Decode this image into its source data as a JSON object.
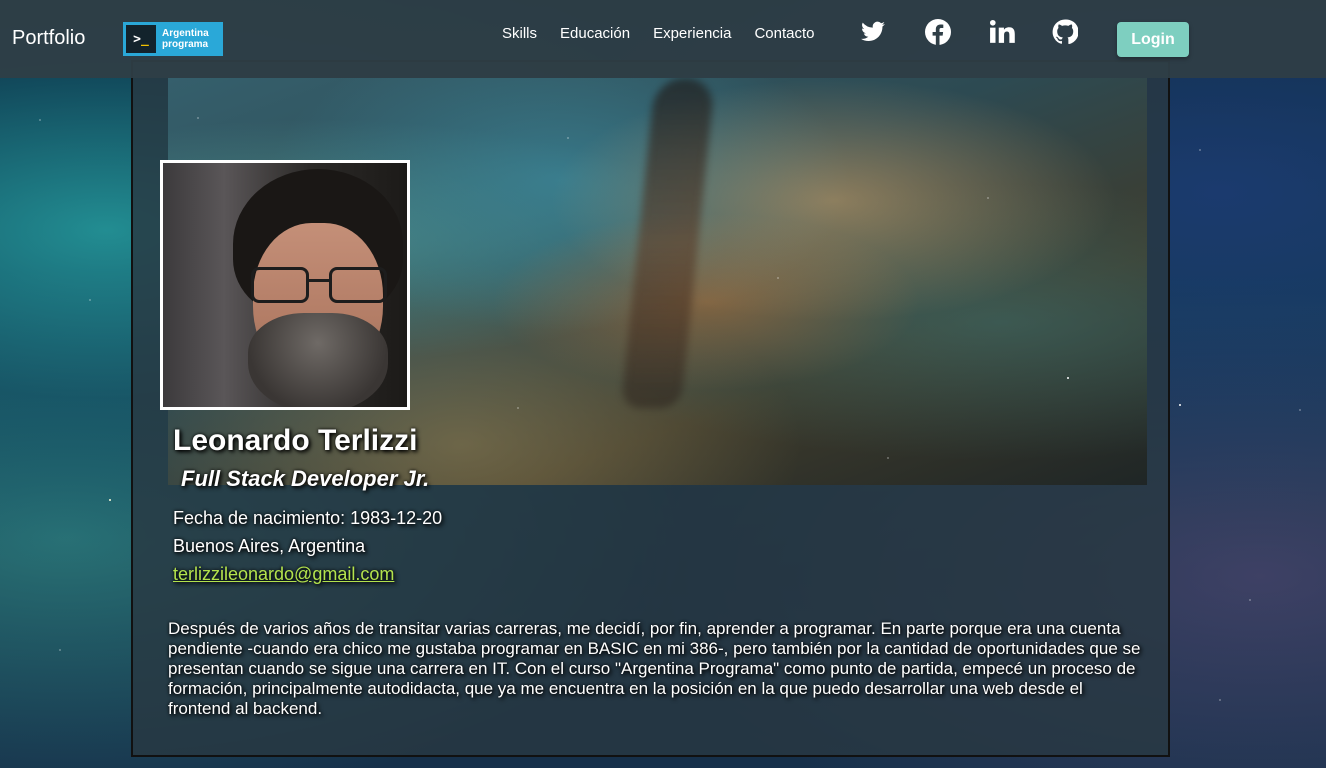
{
  "navbar": {
    "brand": "Portfolio",
    "logo": {
      "prompt": ">",
      "cursor": "_",
      "line1": "Argentina",
      "line2": "programa"
    },
    "links": [
      "Skills",
      "Educación",
      "Experiencia",
      "Contacto"
    ],
    "social_icons": [
      "twitter-icon",
      "facebook-icon",
      "linkedin-icon",
      "github-icon"
    ],
    "login_label": "Login"
  },
  "profile": {
    "name": "Leonardo Terlizzi",
    "title": "Full Stack Developer Jr.",
    "birth": "Fecha de nacimiento: 1983-12-20",
    "location": "Buenos Aires, Argentina",
    "email": "terlizzileonardo@gmail.com",
    "about": "Después de varios años de transitar varias carreras, me decidí, por fin, aprender a programar. En parte porque era una cuenta pendiente -cuando era chico me gustaba programar en BASIC en mi 386-, pero también por la cantidad de oportunidades que se presentan cuando se sigue una carrera en IT. Con el curso \"Argentina Programa\" como punto de partida, empecé un proceso de formación, principalmente autodidacta, que ya me encuentra en la posición en la que puedo desarrollar una web desde el frontend al backend."
  },
  "colors": {
    "navbar_bg": "#2f3e46",
    "login_button": "#7ecfc0",
    "email_link": "#b3e24d"
  }
}
